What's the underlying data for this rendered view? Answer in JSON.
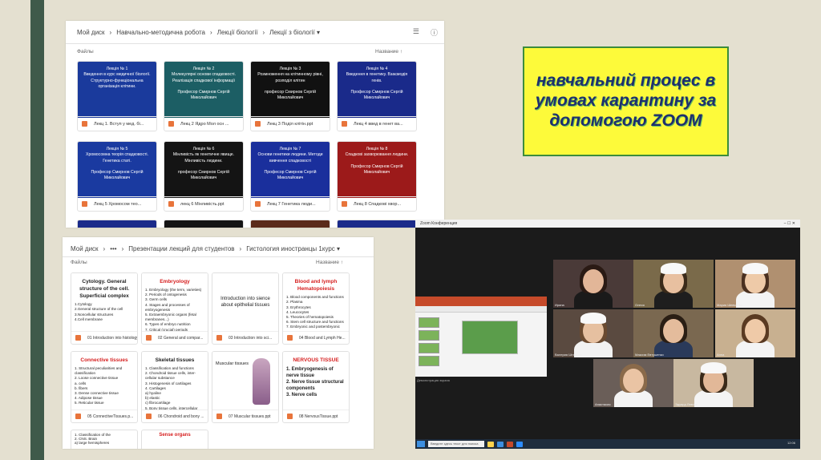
{
  "drive_top": {
    "breadcrumb": [
      "Мой диск",
      "›",
      "Навчально-методична робота",
      "›",
      "Лекції біології",
      "›",
      "Лекції з біології ▾"
    ],
    "files_label": "Файлы",
    "sort_label": "Название",
    "sort_arrow": "↑",
    "tiles": [
      {
        "slide": "Лекція № 1\nВведення в курс медичної біології. Структурно-функціональна організація клітини.",
        "caption": "Лекц 1. Вступ у мед. бі...",
        "color": "#1a3a9c"
      },
      {
        "slide": "Лекція № 2\nМолекулярні основи спадковості. Реалізація спадкової інформації\n\nПрофесор Смирнов Сергій Миколайович",
        "caption": "Лекц 2 Ядро Мол осн ...",
        "color": "#1c5e64"
      },
      {
        "slide": "Лекція № 3\nРозмноження на клітинному рівні, розподіл клітин\n\nпрофесор Смирнов Сергій Миколайович",
        "caption": "Лекц 3 Поділ клітін.ppt",
        "color": "#111111"
      },
      {
        "slide": "Лекція № 4\nВведення в генетику. Взаємодія генів.\n\nПрофесор Смирнов Сергій Миколайович",
        "caption": "Лекц 4 введ в генет ва...",
        "color": "#1a2a8a"
      },
      {
        "slide": "Лекція № 5\nХромосомна теорія спадковості. Генетика статі.\n\nПрофесор Смирнов Сергій Миколайович",
        "caption": "Лекц 5 Хромосом тео...",
        "color": "#1a3aa0"
      },
      {
        "slide": "Лекція № 6\nМінливість як генетичне явище. Мінливість людини.\n\nпрофесор Смирнов Сергій Миколайович",
        "caption": "лекц 6 Мінливість.ppt",
        "color": "#141414"
      },
      {
        "slide": "Лекція № 7\nОснови генетики людини. Методи вивчення спадковості\n\nПрофесор Смирнов Сергій Миколайович",
        "caption": "Лекц 7 Генетика люди...",
        "color": "#1a2f9c"
      },
      {
        "slide": "Лекція № 8\nСпадкові захворювання людини.\n\nПрофесор Смирнов Сергій Миколайович",
        "caption": "Лекц 8 Спадкові хвор...",
        "color": "#9c1a1a"
      }
    ],
    "cut_colors": [
      "#1a2a8a",
      "#141414",
      "#5a2a1a",
      "#1a2a8a"
    ]
  },
  "drive_bottom": {
    "breadcrumb": [
      "Мой диск",
      "›",
      "•••",
      "›",
      "Презентации лекций для студентов",
      "›",
      "Гистология иностранцы 1курс ▾"
    ],
    "files_label": "Файлы",
    "sort_label": "Название",
    "sort_arrow": "↑",
    "tiles": [
      {
        "title": "Cytology. General structure of the cell. Superficial complex",
        "body": "1.Cytology\n2.General structure of the cell\n3.Noncellular structures\n4.Cell membrane",
        "caption": "01 Introduction into histology",
        "title_color": "#222222"
      },
      {
        "title": "Embryology",
        "body": "1. Embryology (the term, varieties)\n2. Periods of ontogenesis\n3. Germ cells\n4. Stages and processes of embryogenesis\n5. Extraembryonic organs (fetal membranes...)\n6. Types of embryo nutrition\n7. Critical (crucial) periods",
        "caption": "02 General and compar...",
        "title_color": "#d62020"
      },
      {
        "title": "",
        "body": "Introduction into sience about epithelial tissues",
        "caption": "03 Introduction into sci...",
        "title_color": "#222222"
      },
      {
        "title": "Blood and lymph Hematopoiesis",
        "body": "1. Blood components and functions\n2. Plasma\n3. Erythrocytes\n4. Leucocytes\n5. Theories of hematopoiesis\n6. Stem cell structure and functions\n7. Embryonic and postembryonic",
        "caption": "04 Blood and Lymph He...",
        "title_color": "#d62020"
      },
      {
        "title": "Connective tissues",
        "body": "1. Structural peculiarities and classification\n2. Loose connective tissue\na. cells\nb. fibers\n3. Dense connective tissue\n4. Adipose tissue\n5. Reticular tissue",
        "caption": "05 ConnectiveTissues.p...",
        "title_color": "#d62020"
      },
      {
        "title": "Skeletal tissues",
        "body": "1. Classification and functions\n2. Chondroid tissue cells, inter-cellular substance\n3. Histogenesis of cartilages\n4. Cartilages\na) hyaline\nb) elastic\nc) fibrocartilage\n5. Bony tissue cells, intercellular substance\n6. Fibrous bones\n7. Lamellar bones",
        "caption": "06 Chondroid and bony ...",
        "title_color": "#222222"
      },
      {
        "title": "",
        "body": "Muscular tissues",
        "caption": "07 Muscular tissues.ppt",
        "title_color": "#222222"
      },
      {
        "title": "NERVOUS TISSUE",
        "body": "1. Embryogenesis of nerve tissue\n2. Nerve tissue structural components\n3. Nerve cells",
        "caption": "08 NervousTissue.ppt",
        "title_color": "#d62020"
      }
    ],
    "cut_texts": [
      "1. Classification of the\n2. CNS. Brain\na) large hemispheres",
      "Sense organs"
    ]
  },
  "title_box": {
    "text": "навчальний процес в умовах карантину за допомогою ZOOM"
  },
  "zoom": {
    "window_title": "Zoom Конференция",
    "share_label": "Демонстрация экрана",
    "taskbar_search": "Введите здесь текст для поиска",
    "clock": "12:06",
    "participants": [
      {
        "name": "Ирина",
        "bg": "#4a3a38",
        "face": "#e2b698",
        "hair": "#2a1a14",
        "cap": false,
        "body": "#1a1a1a"
      },
      {
        "name": "Олеся",
        "bg": "#7a6a4a",
        "face": "#e8c0a0",
        "hair": "#3a2a1a",
        "cap": true,
        "body": "#1e1e1e"
      },
      {
        "name": "Мария Шевченко",
        "bg": "#b09070",
        "face": "#eecaa8",
        "hair": "#4a3020",
        "cap": true,
        "body": "#f4f4f4"
      },
      {
        "name": "Валерия Штанько",
        "bg": "#5a4a40",
        "face": "#e6c0a0",
        "hair": "#6a4a30",
        "cap": true,
        "body": "#f2f2f2"
      },
      {
        "name": "Максим Евтушенко",
        "bg": "#7a6850",
        "face": "#e4bc9c",
        "hair": "#2a1e14",
        "cap": false,
        "body": "#2a3a5a"
      },
      {
        "name": "Анна",
        "bg": "#c8b090",
        "face": "#efcaa8",
        "hair": "#5a3a22",
        "cap": false,
        "body": "#f4f4f4"
      },
      {
        "name": "Анастасия",
        "bg": "#6a5e58",
        "face": "#eac4a4",
        "hair": "#8a6a4a",
        "cap": false,
        "body": "#f4f4f4"
      },
      {
        "name": "Эдуард Левчук",
        "bg": "#c8b8a0",
        "face": "#e2b898",
        "hair": "#3a2a1a",
        "cap": true,
        "body": "#f4f4f4"
      }
    ]
  },
  "colors": {
    "left_bar": "#3f5a4a",
    "background": "#e4e0d0",
    "title_text": "#1e2f6e",
    "title_bg": "#fdfa3a",
    "title_border": "#3c8c3c"
  }
}
